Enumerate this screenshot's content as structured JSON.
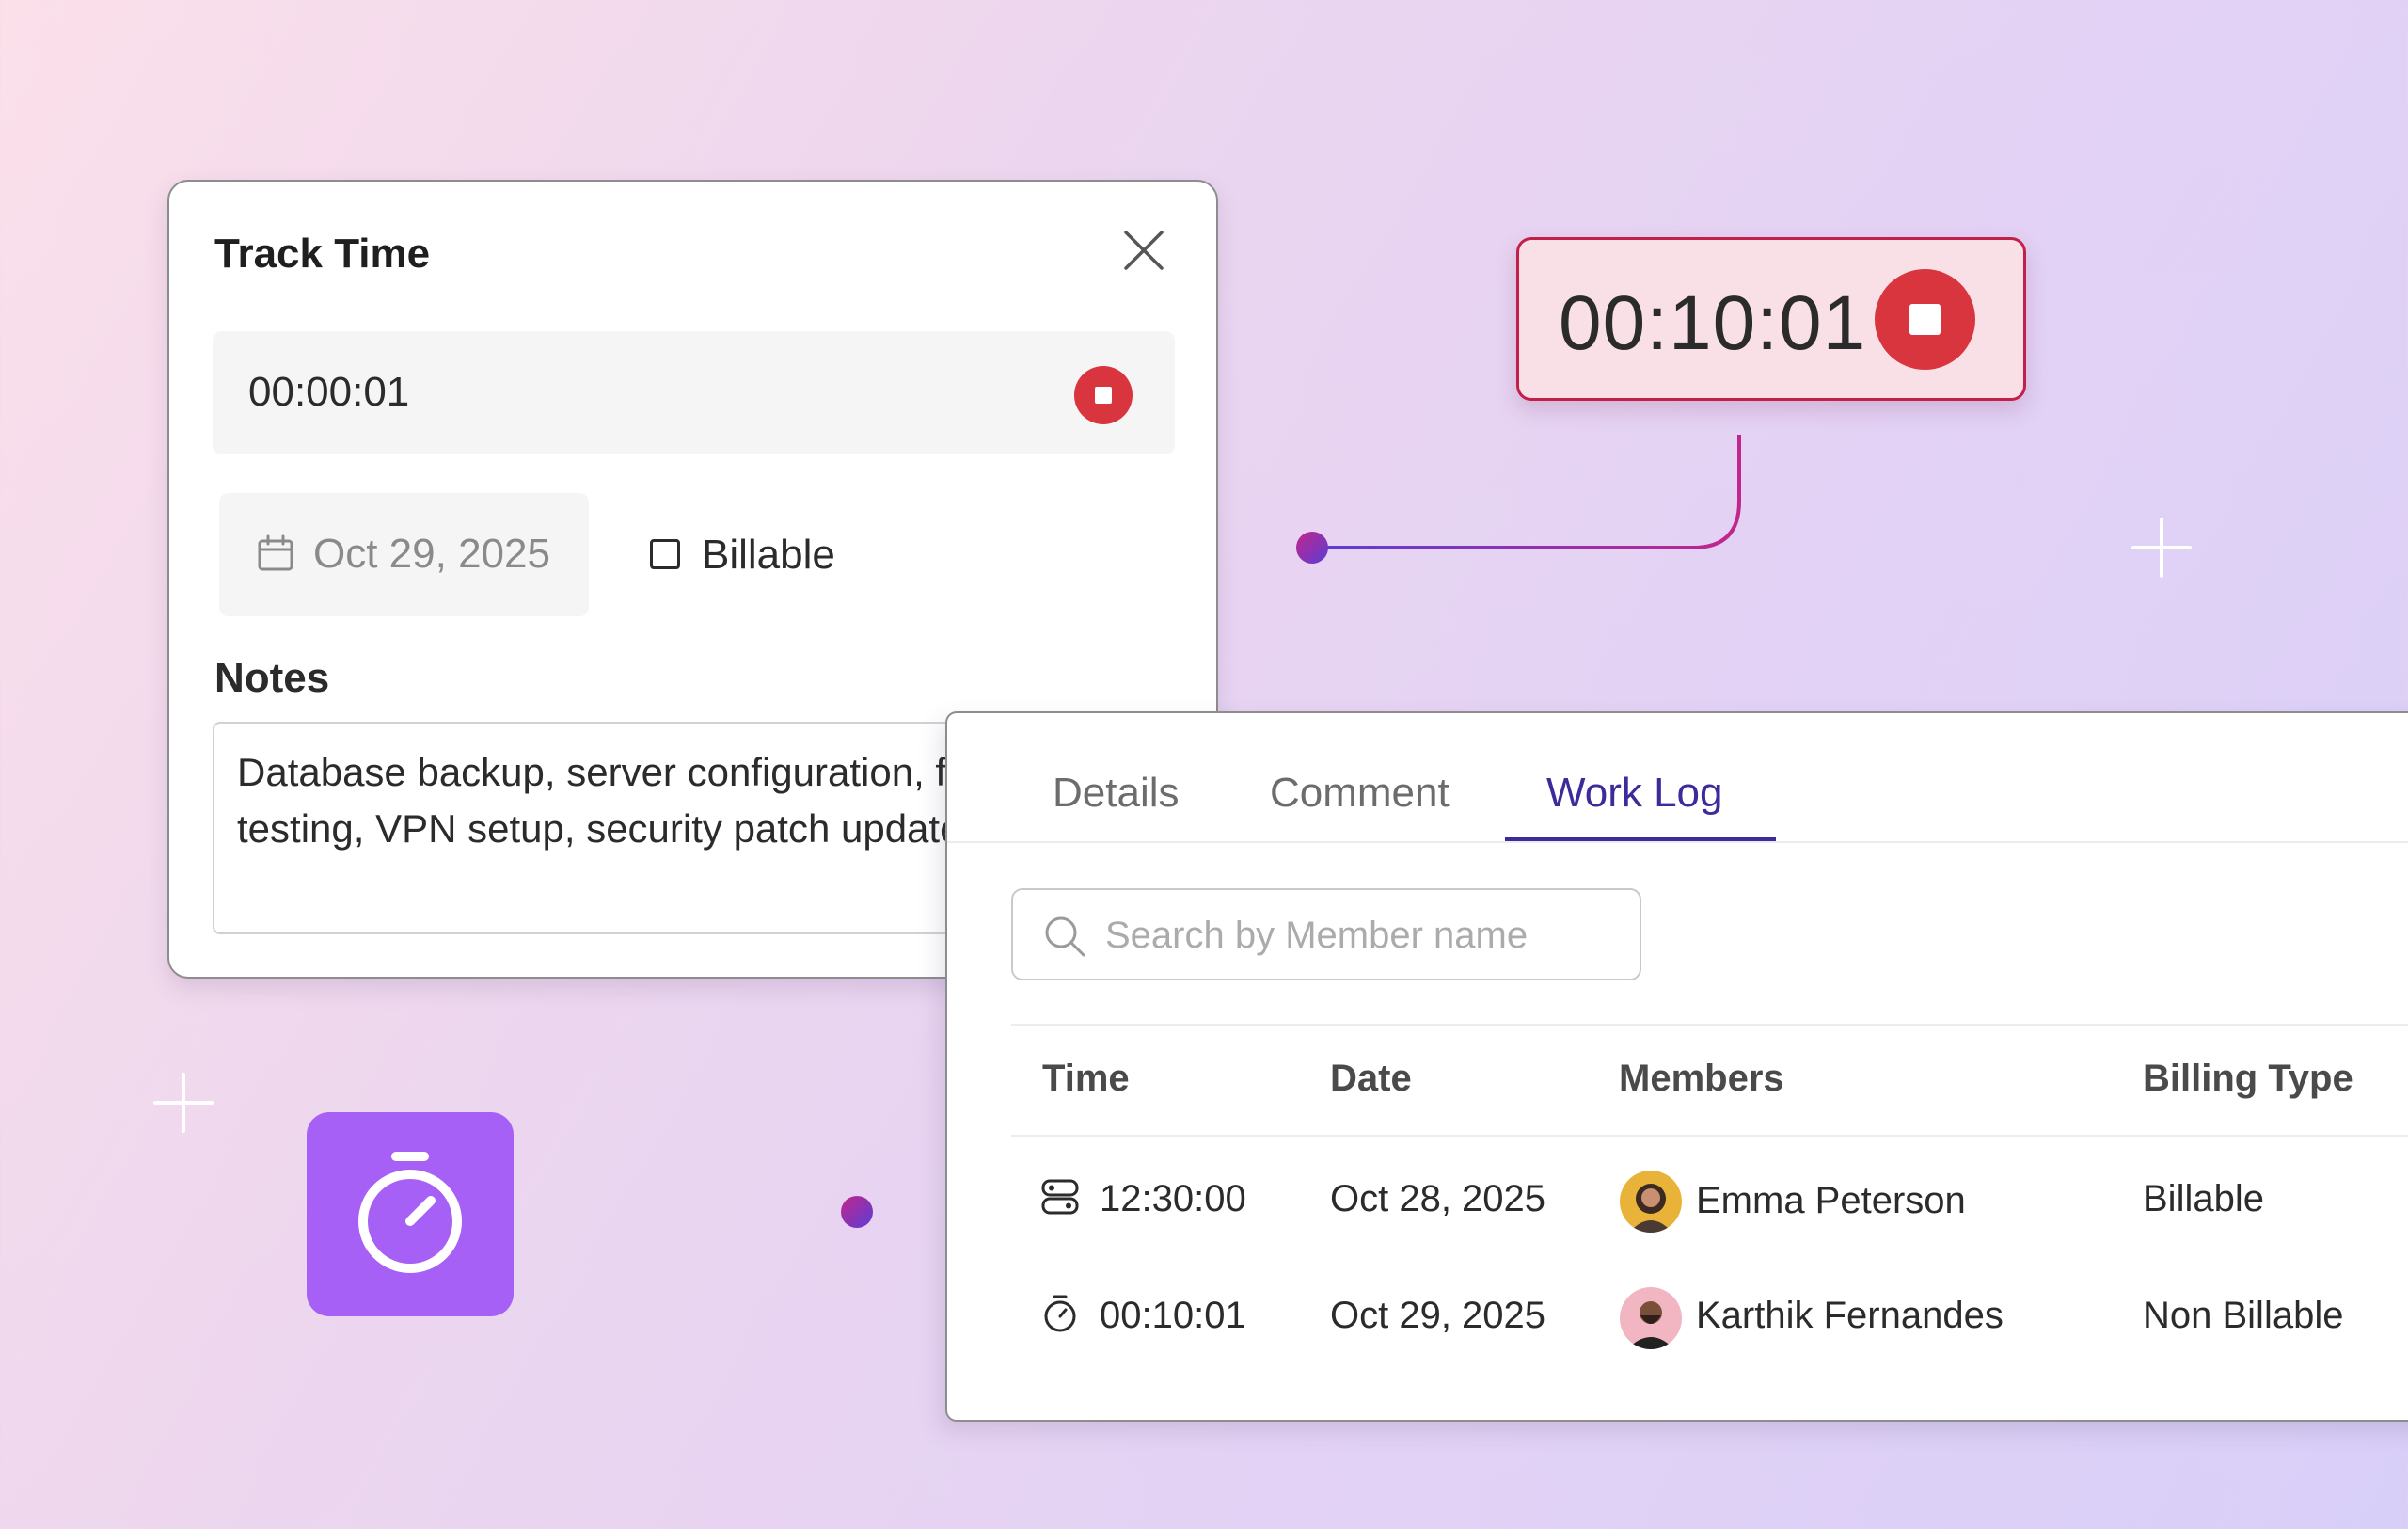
{
  "track_time": {
    "title": "Track Time",
    "timer_value": "00:00:01",
    "date": "Oct 29, 2025",
    "billable_label": "Billable",
    "billable_checked": false,
    "notes_label": "Notes",
    "notes_text": "Database backup, server configuration, firewall testing, VPN setup, security patch updates"
  },
  "running_timer": {
    "value": "00:10:01"
  },
  "work_panel": {
    "tabs": [
      {
        "label": "Details",
        "active": false
      },
      {
        "label": "Comment",
        "active": false
      },
      {
        "label": "Work Log",
        "active": true
      }
    ],
    "search_placeholder": "Search by Member name",
    "columns": [
      "Time",
      "Date",
      "Members",
      "Billing Type"
    ],
    "rows": [
      {
        "icon": "manual-entry-icon",
        "time": "12:30:00",
        "date": "Oct 28, 2025",
        "member": "Emma Peterson",
        "billing": "Billable"
      },
      {
        "icon": "stopwatch-icon",
        "time": "00:10:01",
        "date": "Oct 29, 2025",
        "member": "Karthik Fernandes",
        "billing": "Non Billable"
      }
    ]
  },
  "colors": {
    "accent": "#3b2c9a",
    "stop_red": "#d8353f",
    "timer_border": "#c21f4a",
    "tile_purple": "#a760f5"
  }
}
